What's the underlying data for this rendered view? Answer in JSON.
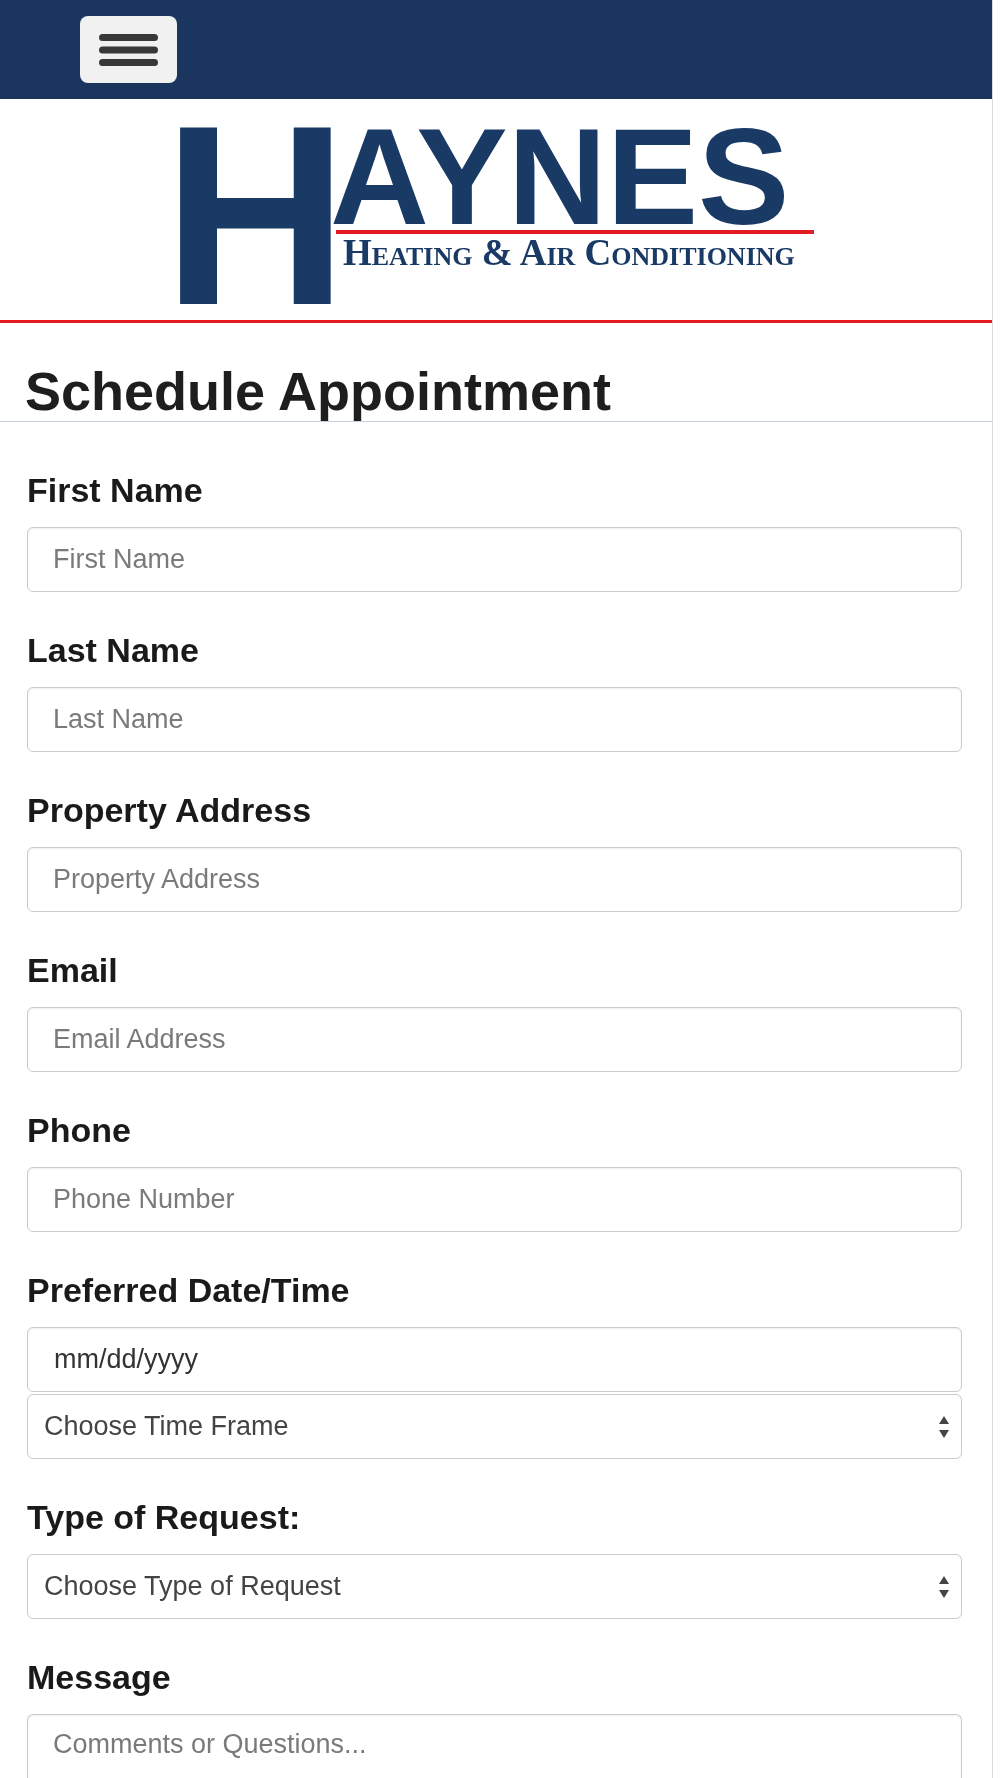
{
  "logo": {
    "initial": "H",
    "wordmark": "AYNES",
    "tagline": "Heating & Air Conditioning"
  },
  "form": {
    "title": "Schedule Appointment",
    "groups": [
      {
        "label": "First Name",
        "fields": [
          {
            "kind": "text",
            "placeholder": "First Name"
          }
        ]
      },
      {
        "label": "Last Name",
        "fields": [
          {
            "kind": "text",
            "placeholder": "Last Name"
          }
        ]
      },
      {
        "label": "Property Address",
        "fields": [
          {
            "kind": "text",
            "placeholder": "Property Address"
          }
        ]
      },
      {
        "label": "Email",
        "fields": [
          {
            "kind": "text",
            "placeholder": "Email Address"
          }
        ]
      },
      {
        "label": "Phone",
        "fields": [
          {
            "kind": "text",
            "placeholder": "Phone Number"
          }
        ]
      },
      {
        "label": "Preferred Date/Time",
        "fields": [
          {
            "kind": "date",
            "placeholder": "mm/dd/yyyy"
          },
          {
            "kind": "select",
            "value": "Choose Time Frame"
          }
        ]
      },
      {
        "label": "Type of Request:",
        "fields": [
          {
            "kind": "select",
            "value": "Choose Type of Request"
          }
        ]
      },
      {
        "label": "Message",
        "fields": [
          {
            "kind": "textarea",
            "placeholder": "Comments or Questions..."
          }
        ]
      }
    ]
  }
}
